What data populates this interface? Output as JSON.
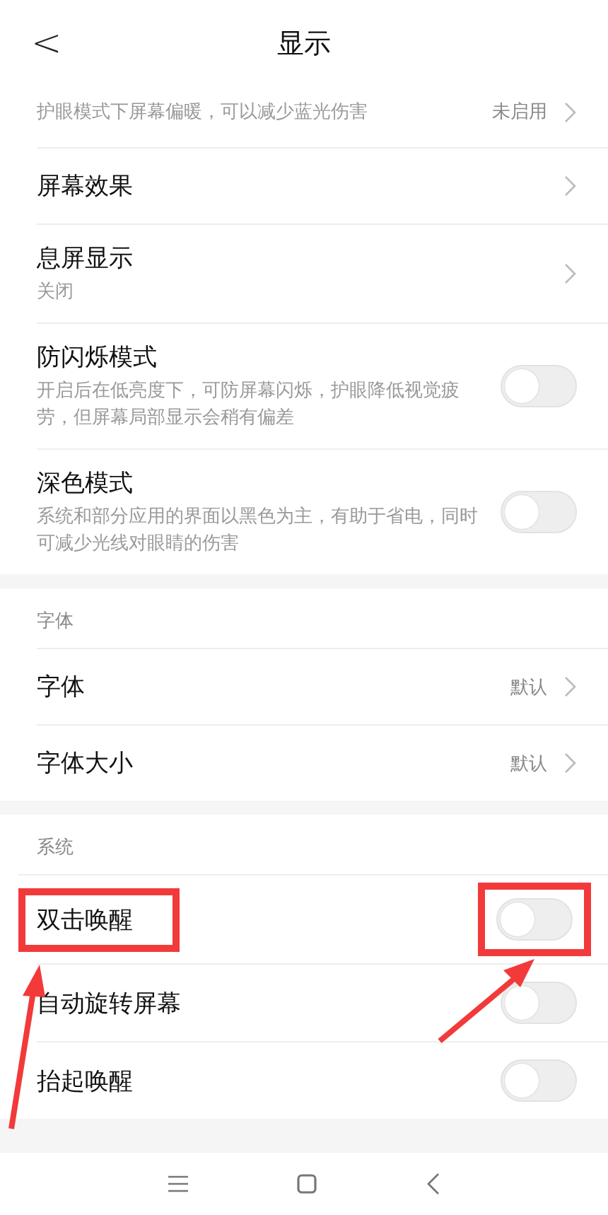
{
  "header": {
    "back": "<",
    "title": "显示"
  },
  "sections": [
    {
      "items": [
        {
          "kind": "chevron",
          "subtitle": "护眼模式下屏幕偏暖，可以减少蓝光伤害",
          "value": "未启用"
        },
        {
          "kind": "chevron",
          "title": "屏幕效果"
        },
        {
          "kind": "chevron",
          "title": "息屏显示",
          "subtitle": "关闭"
        },
        {
          "kind": "toggle",
          "title": "防闪烁模式",
          "subtitle": "开启后在低亮度下，可防屏幕闪烁，护眼降低视觉疲劳，但屏幕局部显示会稍有偏差",
          "on": false
        },
        {
          "kind": "toggle",
          "title": "深色模式",
          "subtitle": "系统和部分应用的界面以黑色为主，有助于省电，同时可减少光线对眼睛的伤害",
          "on": false
        }
      ]
    },
    {
      "label": "字体",
      "items": [
        {
          "kind": "chevron",
          "title": "字体",
          "value": "默认"
        },
        {
          "kind": "chevron",
          "title": "字体大小",
          "value": "默认"
        }
      ]
    },
    {
      "label": "系统",
      "items": [
        {
          "kind": "toggle",
          "title": "双击唤醒",
          "on": false,
          "highlighted": true
        },
        {
          "kind": "toggle",
          "title": "自动旋转屏幕",
          "on": false
        },
        {
          "kind": "toggle",
          "title": "抬起唤醒",
          "on": false
        }
      ]
    }
  ]
}
